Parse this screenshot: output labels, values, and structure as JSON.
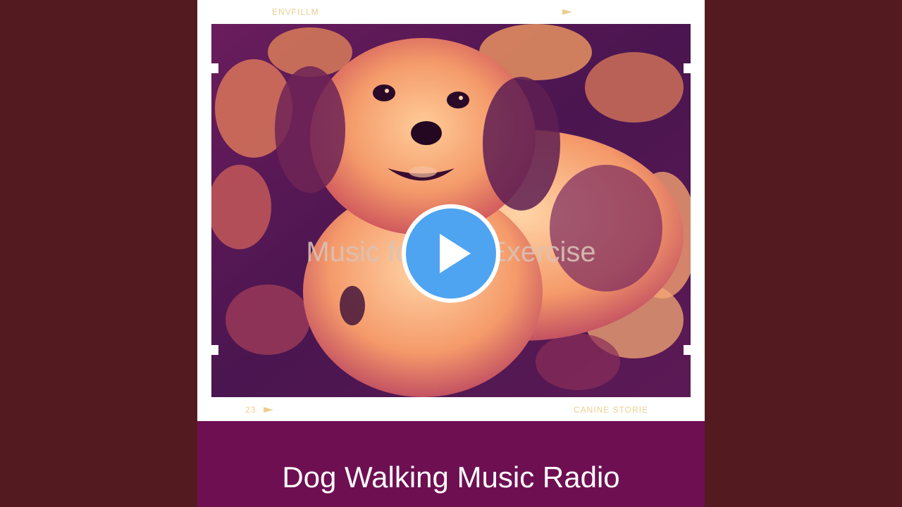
{
  "cover": {
    "film_brand": "ENVFILLM",
    "frame_number": "23",
    "film_stock": "CANINE STORIE",
    "overlay_title": "Music for Dog Exercise",
    "artist": "Dog Walking Music Radio"
  },
  "player": {
    "play_icon": "play-icon",
    "play_color": "#4ea4f0"
  },
  "colors": {
    "background": "#531b1f",
    "band": "#6e0f52",
    "film_text": "#e7c77a"
  }
}
